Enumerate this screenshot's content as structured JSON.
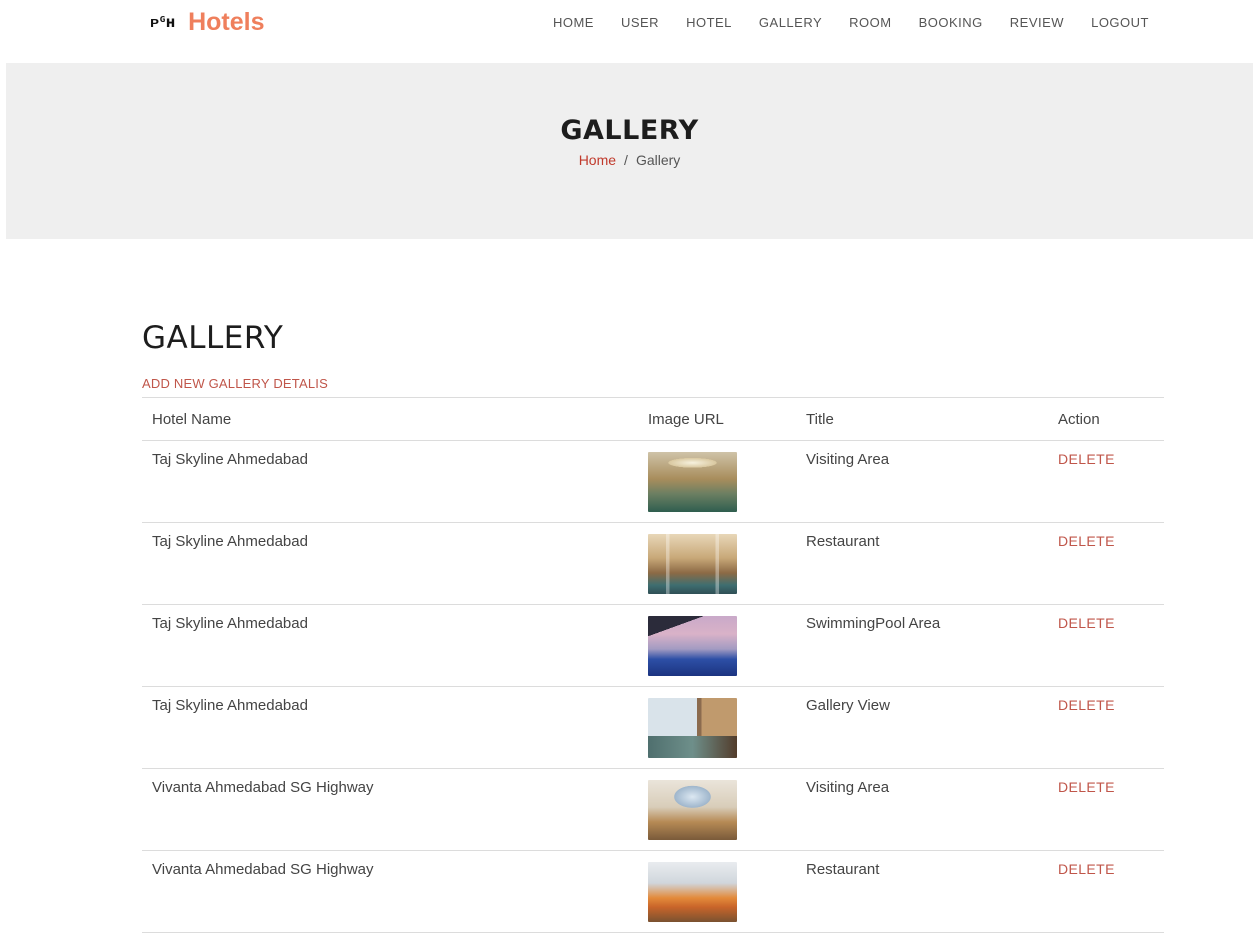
{
  "brand": {
    "mark": "ᴘᴳʜ",
    "name": "Hotels"
  },
  "nav": {
    "items": [
      "HOME",
      "USER",
      "HOTEL",
      "GALLERY",
      "ROOM",
      "BOOKING",
      "REVIEW",
      "LOGOUT"
    ]
  },
  "hero": {
    "title": "GALLERY",
    "breadcrumb_home": "Home",
    "breadcrumb_separator": "/",
    "breadcrumb_current": "Gallery"
  },
  "main": {
    "heading": "GALLERY",
    "add_link": "ADD NEW GALLERY DETALIS",
    "table": {
      "headers": [
        "Hotel Name",
        "Image URL",
        "Title",
        "Action"
      ],
      "rows": [
        {
          "hotel": "Taj Skyline Ahmedabad",
          "image": "thumbnail-lobby",
          "title": "Visiting Area",
          "action": "DELETE"
        },
        {
          "hotel": "Taj Skyline Ahmedabad",
          "image": "thumbnail-restaurant",
          "title": "Restaurant",
          "action": "DELETE"
        },
        {
          "hotel": "Taj Skyline Ahmedabad",
          "image": "thumbnail-pool",
          "title": "SwimmingPool Area",
          "action": "DELETE"
        },
        {
          "hotel": "Taj Skyline Ahmedabad",
          "image": "thumbnail-room",
          "title": "Gallery View",
          "action": "DELETE"
        },
        {
          "hotel": "Vivanta Ahmedabad SG Highway",
          "image": "thumbnail-dome-lobby",
          "title": "Visiting Area",
          "action": "DELETE"
        },
        {
          "hotel": "Vivanta Ahmedabad SG Highway",
          "image": "thumbnail-dining",
          "title": "Restaurant",
          "action": "DELETE"
        }
      ]
    }
  },
  "colors": {
    "brand": "#ef7f5c",
    "accent": "#c0564a",
    "hero_bg": "#efefef"
  }
}
